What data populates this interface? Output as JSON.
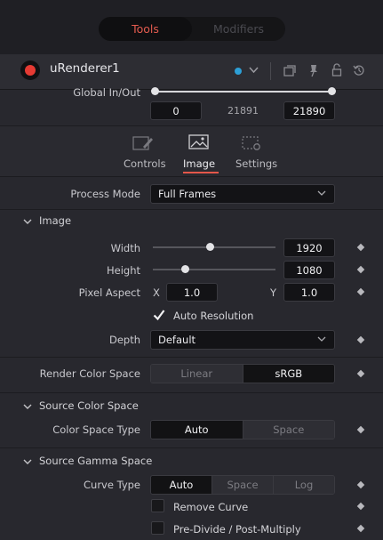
{
  "tabs": {
    "tools": "Tools",
    "modifiers": "Modifiers"
  },
  "node": {
    "name": "uRenderer1",
    "color": "#e53a33",
    "dot_color": "#2d9fd6"
  },
  "header_icons": [
    "chevron-down-icon",
    "window-icon",
    "pin-icon",
    "lock-icon",
    "reset-icon"
  ],
  "global": {
    "label": "Global In/Out",
    "start": "0",
    "mid": "21891",
    "end": "21890"
  },
  "subtabs": [
    {
      "label": "Controls",
      "icon": "controls-icon"
    },
    {
      "label": "Image",
      "icon": "image-icon",
      "active": true
    },
    {
      "label": "Settings",
      "icon": "settings-icon"
    }
  ],
  "process_mode": {
    "label": "Process Mode",
    "value": "Full Frames"
  },
  "image_section": {
    "title": "Image",
    "width": {
      "label": "Width",
      "value": "1920",
      "slider_fraction": 0.47
    },
    "height": {
      "label": "Height",
      "value": "1080",
      "slider_fraction": 0.25
    },
    "pixel_aspect": {
      "label": "Pixel Aspect",
      "x_label": "X",
      "x": "1.0",
      "y_label": "Y",
      "y": "1.0"
    },
    "auto_resolution": {
      "label": "Auto Resolution",
      "checked": true
    },
    "depth": {
      "label": "Depth",
      "value": "Default"
    }
  },
  "render_color_space": {
    "label": "Render Color Space",
    "options": [
      "Linear",
      "sRGB"
    ],
    "selected": "sRGB"
  },
  "source_color_space": {
    "title": "Source Color Space",
    "type_label": "Color Space Type",
    "options": [
      "Auto",
      "Space"
    ],
    "selected": "Auto"
  },
  "source_gamma_space": {
    "title": "Source Gamma Space",
    "curve_label": "Curve Type",
    "options": [
      "Auto",
      "Space",
      "Log"
    ],
    "selected": "Auto",
    "remove_curve": {
      "label": "Remove Curve",
      "checked": false
    },
    "predivide": {
      "label": "Pre-Divide / Post-Multiply",
      "checked": false
    }
  },
  "colors": {
    "accent": "#e4574a",
    "panel": "#28282e",
    "field": "#131316"
  }
}
